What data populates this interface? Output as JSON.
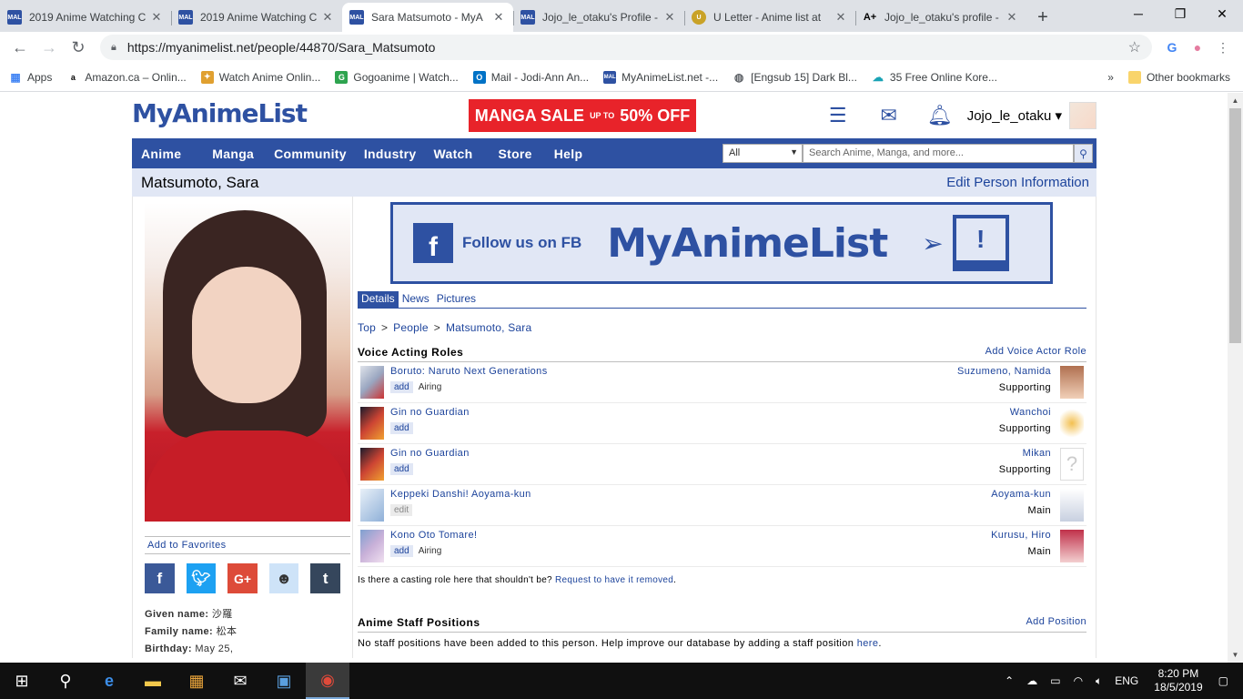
{
  "browser": {
    "tabs": [
      {
        "title": "2019 Anime Watching C",
        "active": false,
        "fav": "MAL"
      },
      {
        "title": "2019 Anime Watching C",
        "active": false,
        "fav": "MAL"
      },
      {
        "title": "Sara Matsumoto - MyA",
        "active": true,
        "fav": "MAL"
      },
      {
        "title": "Jojo_le_otaku's Profile -",
        "active": false,
        "fav": "MAL"
      },
      {
        "title": "U Letter - Anime list at",
        "active": false,
        "fav": "U"
      },
      {
        "title": "Jojo_le_otaku's profile -",
        "active": false,
        "fav": "A+"
      }
    ],
    "url": "https://myanimelist.net/people/44870/Sara_Matsumoto",
    "bookmarks": [
      {
        "label": "Apps",
        "icon": "apps-grid-icon"
      },
      {
        "label": "Amazon.ca – Onlin...",
        "icon": "amazon-icon"
      },
      {
        "label": "Watch Anime Onlin...",
        "icon": "anime-site-icon"
      },
      {
        "label": "Gogoanime | Watch...",
        "icon": "gogoanime-icon"
      },
      {
        "label": "Mail - Jodi-Ann An...",
        "icon": "outlook-icon"
      },
      {
        "label": "MyAnimeList.net -...",
        "icon": "mal-icon"
      },
      {
        "label": "[Engsub 15] Dark Bl...",
        "icon": "globe-icon"
      },
      {
        "label": "35 Free Online Kore...",
        "icon": "korean-site-icon"
      }
    ],
    "other_bookmarks": "Other bookmarks"
  },
  "header": {
    "logo": "MyAnimeList",
    "sale_main": "MANGA SALE",
    "sale_upto": "UP TO",
    "sale_pct": "50% OFF",
    "username": "Jojo_le_otaku"
  },
  "menu": {
    "items": [
      "Anime",
      "Manga",
      "Community",
      "Industry",
      "Watch",
      "Store",
      "Help"
    ],
    "search_filter": "All",
    "search_placeholder": "Search Anime, Manga, and more..."
  },
  "person": {
    "name": "Matsumoto, Sara",
    "edit_link": "Edit Person Information",
    "add_favorites": "Add to Favorites",
    "given_name_label": "Given name:",
    "given_name": "沙羅",
    "family_name_label": "Family name:",
    "family_name": "松本",
    "birthday_label": "Birthday:",
    "birthday": "May 25,"
  },
  "banner": {
    "follow": "Follow us on FB",
    "logo": "MyAnimeList"
  },
  "subtabs": [
    "Details",
    "News",
    "Pictures"
  ],
  "breadcrumb": [
    "Top",
    "People",
    "Matsumoto, Sara"
  ],
  "voice_roles": {
    "title": "Voice Acting Roles",
    "add_link": "Add Voice Actor Role",
    "rows": [
      {
        "anime": "Boruto: Naruto Next Generations",
        "badge": "add",
        "status": "Airing",
        "character": "Suzumeno, Namida",
        "role": "Supporting"
      },
      {
        "anime": "Gin no Guardian",
        "badge": "add",
        "status": "",
        "character": "Wanchoi",
        "role": "Supporting"
      },
      {
        "anime": "Gin no Guardian",
        "badge": "add",
        "status": "",
        "character": "Mikan",
        "role": "Supporting"
      },
      {
        "anime": "Keppeki Danshi! Aoyama-kun",
        "badge": "edit",
        "status": "",
        "character": "Aoyama-kun",
        "role": "Main"
      },
      {
        "anime": "Kono Oto Tomare!",
        "badge": "add",
        "status": "Airing",
        "character": "Kurusu, Hiro",
        "role": "Main"
      }
    ],
    "casting_text": "Is there a casting role here that shouldn't be?",
    "casting_link": "Request to have it removed",
    "casting_end": "."
  },
  "staff": {
    "title": "Anime Staff Positions",
    "add_link": "Add Position",
    "empty_text": "No staff positions have been added to this person. Help improve our database by adding a staff position",
    "here_link": "here",
    "end": "."
  },
  "taskbar": {
    "language": "ENG",
    "time": "8:20 PM",
    "date": "18/5/2019"
  },
  "colors": {
    "mal_blue": "#2e51a2",
    "mal_light": "#e1e7f5",
    "link": "#1c439b",
    "sale_red": "#e8232a"
  }
}
